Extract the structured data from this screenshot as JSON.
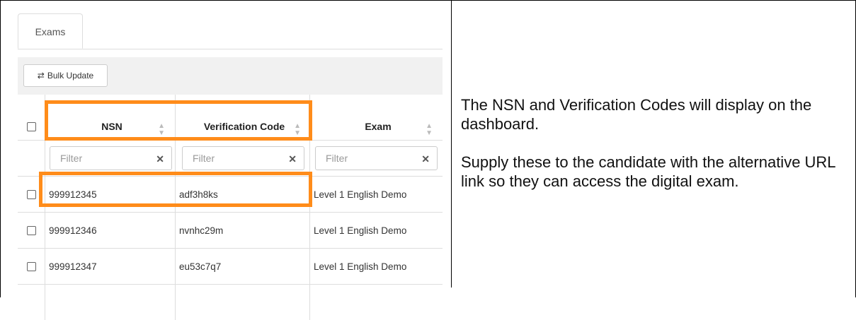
{
  "tabs": {
    "exams_label": "Exams"
  },
  "toolbar": {
    "bulk_update_label": "Bulk Update",
    "bulk_update_icon": "exchange-arrows-icon"
  },
  "table": {
    "headers": {
      "nsn": "NSN",
      "verification_code": "Verification Code",
      "exam": "Exam"
    },
    "filter_placeholder": "Filter",
    "rows": [
      {
        "nsn": "999912345",
        "verification_code": "adf3h8ks",
        "exam": "Level 1 English Demo"
      },
      {
        "nsn": "999912346",
        "verification_code": "nvnhc29m",
        "exam": "Level 1 English Demo"
      },
      {
        "nsn": "999912347",
        "verification_code": "eu53c7q7",
        "exam": "Level 1 English Demo"
      }
    ]
  },
  "note": {
    "paragraph1": "The NSN and Verification Codes will display on the dashboard.",
    "paragraph2": "Supply these to the candidate with the alternative URL link so they can access the digital exam."
  },
  "colors": {
    "highlight": "#ff8c1a",
    "toolbar_bg": "#f1f1f1",
    "border": "#dddddd"
  }
}
